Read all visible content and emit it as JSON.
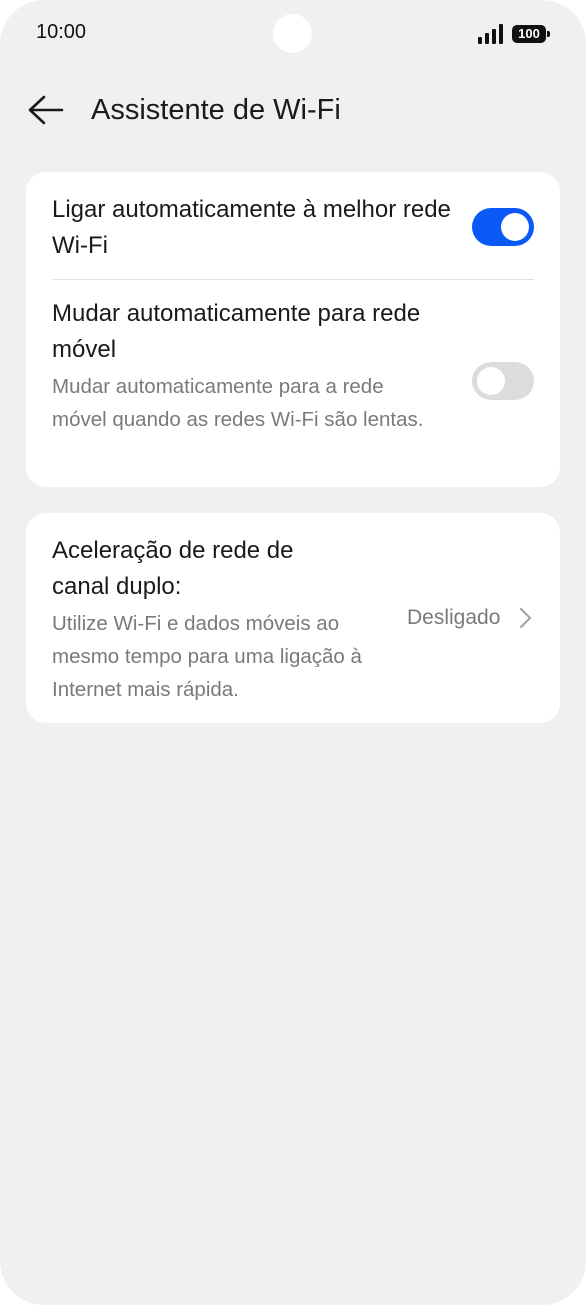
{
  "status_bar": {
    "time": "10:00",
    "battery": "100",
    "icons": [
      "signal-icon",
      "battery-icon",
      "front-camera"
    ]
  },
  "header": {
    "title": "Assistente de Wi-Fi",
    "back_icon": "arrow-left-icon"
  },
  "settings": {
    "auto_best_wifi": {
      "title": "Ligar automaticamente à melhor rede Wi-Fi",
      "enabled": true
    },
    "auto_mobile": {
      "title": "Mudar automaticamente para rede móvel",
      "description": "Mudar automaticamente para a rede móvel quando as redes Wi-Fi são lentas.",
      "enabled": false
    },
    "dual_channel": {
      "title": "Aceleração de rede de canal duplo:",
      "description": "Utilize Wi-Fi e dados móveis ao mesmo tempo para uma ligação à Internet mais rápida.",
      "value": "Desligado",
      "chevron_icon": "chevron-right-icon"
    }
  },
  "colors": {
    "accent": "#0a59f7",
    "background": "#eff0f2",
    "card": "#ffffff",
    "secondary_text": "#7a7a7a",
    "toggle_off": "#dcdcde"
  }
}
